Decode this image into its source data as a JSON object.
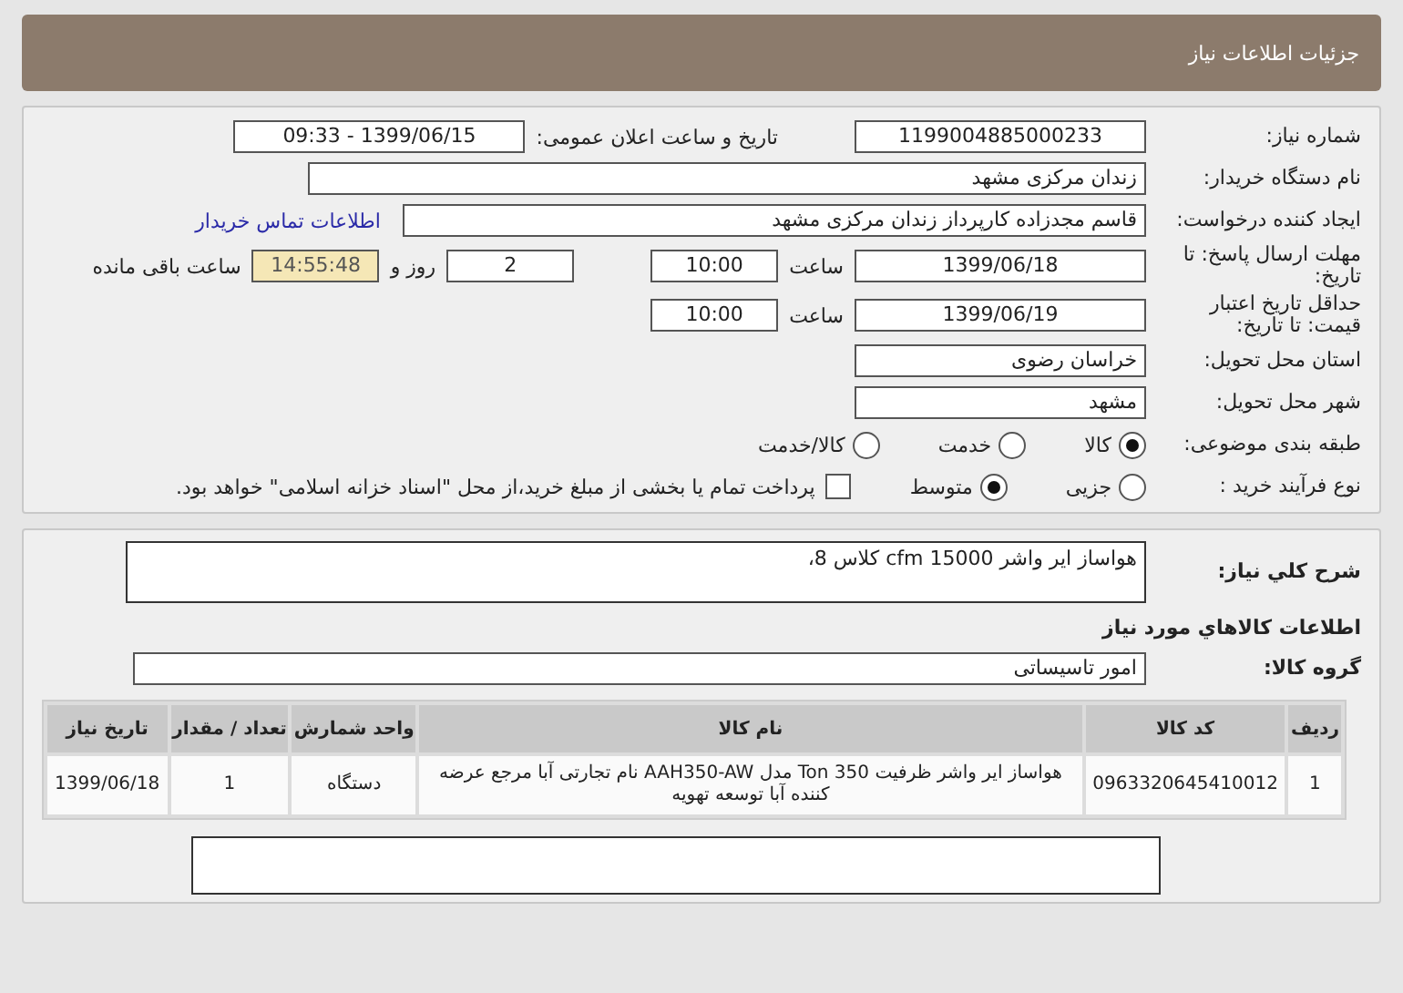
{
  "header": {
    "title": "جزئیات اطلاعات نیاز"
  },
  "details": {
    "need_number": {
      "label": "شماره نیاز:",
      "value": "1199004885000233"
    },
    "announce": {
      "label": "تاریخ و ساعت اعلان عمومی:",
      "value": "1399/06/15 - 09:33"
    },
    "buyer": {
      "label": "نام دستگاه خریدار:",
      "value": "زندان مرکزی مشهد"
    },
    "creator": {
      "label": "ایجاد کننده درخواست:",
      "value": "قاسم مجدزاده کارپرداز زندان مرکزی مشهد",
      "link": "اطلاعات تماس خریدار"
    },
    "reply_deadline": {
      "label": "مهلت ارسال پاسخ: تا تاریخ:",
      "date": "1399/06/18",
      "time_label": "ساعت",
      "time": "10:00",
      "days": "2",
      "days_label": "روز و",
      "remaining": "14:55:48",
      "remaining_label": "ساعت باقی مانده"
    },
    "price_deadline": {
      "label": "حداقل تاریخ اعتبار قیمت: تا تاریخ:",
      "date": "1399/06/19",
      "time_label": "ساعت",
      "time": "10:00"
    },
    "province": {
      "label": "استان محل تحویل:",
      "value": "خراسان رضوی"
    },
    "city": {
      "label": "شهر محل تحویل:",
      "value": "مشهد"
    },
    "category": {
      "label": "طبقه بندی موضوعی:",
      "options": [
        {
          "label": "کالا",
          "selected": true
        },
        {
          "label": "خدمت",
          "selected": false
        },
        {
          "label": "کالا/خدمت",
          "selected": false
        }
      ]
    },
    "process": {
      "label": "نوع فرآیند خرید :",
      "options": [
        {
          "label": "جزیی",
          "selected": false
        },
        {
          "label": "متوسط",
          "selected": true
        }
      ],
      "payment": {
        "label": "پرداخت تمام یا بخشی از مبلغ خرید،از محل \"اسناد خزانه اسلامی\" خواهد بود.",
        "checked": false
      }
    }
  },
  "summary": {
    "label": "شرح کلي نياز:",
    "value": "هواساز ایر واشر cfm 15000 کلاس 8،",
    "items_heading": "اطلاعات کالاهاي مورد نياز",
    "group": {
      "label": "گروه کالا:",
      "value": "امور تاسیساتی"
    },
    "table": {
      "columns": [
        "ردیف",
        "کد کالا",
        "نام کالا",
        "واحد شمارش",
        "تعداد / مقدار",
        "تاریخ نیاز"
      ],
      "rows": [
        [
          "1",
          "0963320645410012",
          "هواساز ایر واشر ظرفیت Ton 350 مدل AAH350-AW نام تجارتی آبا مرجع عرضه کننده آبا توسعه تهویه",
          "دستگاه",
          "1",
          "1399/06/18"
        ]
      ]
    }
  }
}
